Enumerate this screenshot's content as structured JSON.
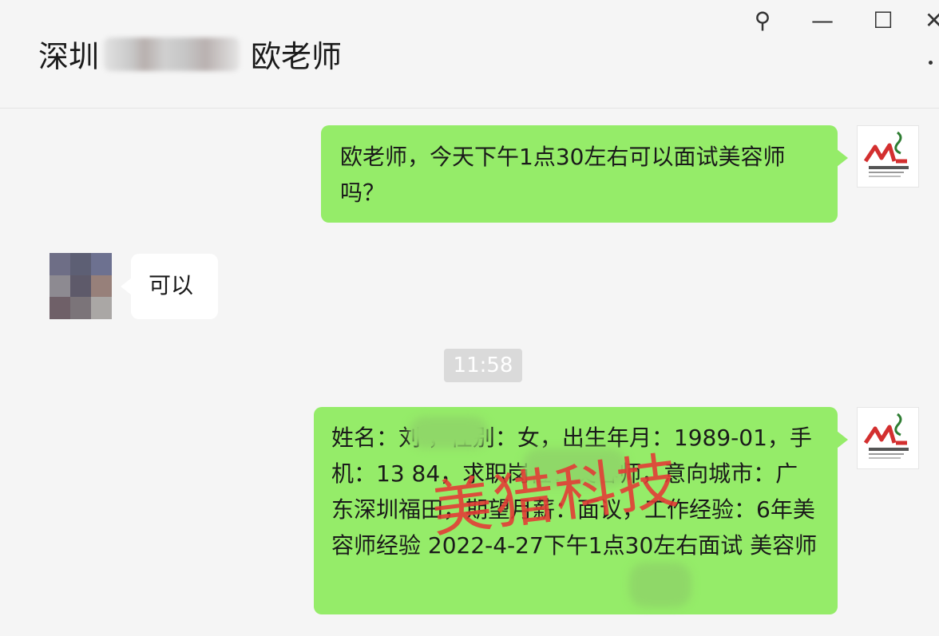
{
  "header": {
    "title_prefix": "深圳",
    "title_suffix": "欧老师"
  },
  "window_controls": {
    "pin_icon": "⚲",
    "minimize_icon": "—",
    "maximize_icon": "☐",
    "close_icon": "✕"
  },
  "messages": [
    {
      "side": "right",
      "text": "欧老师，今天下午1点30左右可以面试美容师吗？"
    },
    {
      "side": "left",
      "text": "可以"
    },
    {
      "side": "right",
      "text": "姓名：刘       ，性别：女，出生年月：1989-01，手机：13          84，求职岗位：美容师，意向城市：广东深圳福田，期望月薪：面议，工作经验：6年美容师经验 2022-4-27下午1点30左右面试         美容师"
    }
  ],
  "timestamp": "11:58",
  "watermark": "美猎科技",
  "colors": {
    "self_bubble": "#95ec69",
    "other_bubble": "#ffffff",
    "watermark": "#e53935"
  },
  "icons": {
    "self_avatar": "meilie-logo-icon",
    "other_avatar": "pixelated-avatar-icon"
  }
}
